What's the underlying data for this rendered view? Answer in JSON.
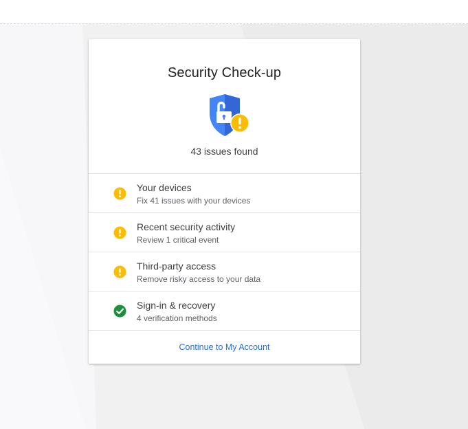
{
  "card": {
    "title": "Security Check-up",
    "issues_found": "43 issues found",
    "header_icon": "shield-unlocked-warning-icon"
  },
  "items": [
    {
      "title": "Your devices",
      "subtitle": "Fix 41 issues with your devices",
      "status": "warning",
      "status_icon": "warning-icon"
    },
    {
      "title": "Recent security activity",
      "subtitle": "Review 1 critical event",
      "status": "warning",
      "status_icon": "warning-icon"
    },
    {
      "title": "Third-party access",
      "subtitle": "Remove risky access to your data",
      "status": "warning",
      "status_icon": "warning-icon"
    },
    {
      "title": "Sign-in & recovery",
      "subtitle": "4 verification methods",
      "status": "ok",
      "status_icon": "check-icon"
    }
  ],
  "footer": {
    "continue_label": "Continue to My Account"
  },
  "colors": {
    "shield_blue": "#4285f4",
    "warning_yellow": "#fbbc04",
    "success_green": "#1e8e3e",
    "link_blue": "#2a6fc9"
  }
}
